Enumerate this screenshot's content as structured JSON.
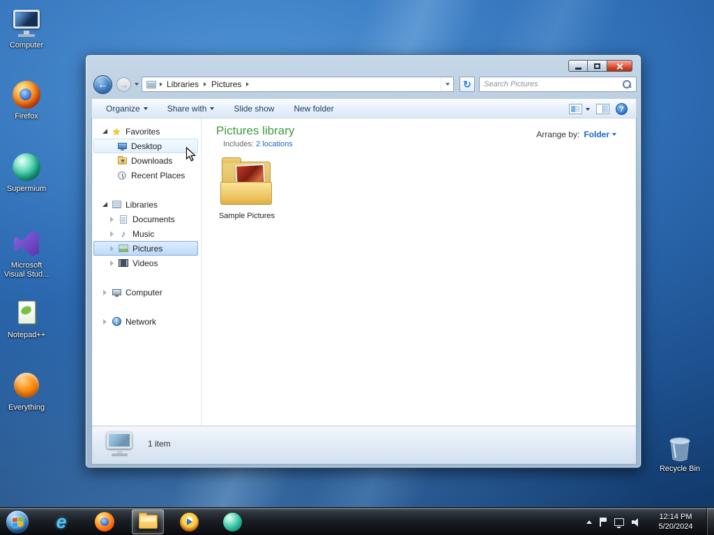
{
  "colors": {
    "selection_blue": "#84acdd",
    "library_title_green": "#3e9b3e",
    "link_blue": "#1a66cc",
    "toolbar_text": "#1e3c5a",
    "close_button_red": "#c03318"
  },
  "desktop": {
    "icons": [
      {
        "label": "Computer"
      },
      {
        "label": "Firefox"
      },
      {
        "label": "Supermium"
      },
      {
        "label": "Microsoft Visual Stud..."
      },
      {
        "label": "Notepad++"
      },
      {
        "label": "Everything"
      },
      {
        "label": "Recycle Bin"
      }
    ]
  },
  "window": {
    "nav": {
      "breadcrumb": [
        {
          "label": "Libraries"
        },
        {
          "label": "Pictures"
        }
      ],
      "search_placeholder": "Search Pictures"
    },
    "toolbar": {
      "organize": "Organize",
      "share_with": "Share with",
      "slide_show": "Slide show",
      "new_folder": "New folder"
    },
    "sidebar": {
      "favorites": {
        "label": "Favorites",
        "items": [
          {
            "label": "Desktop"
          },
          {
            "label": "Downloads"
          },
          {
            "label": "Recent Places"
          }
        ]
      },
      "libraries": {
        "label": "Libraries",
        "items": [
          {
            "label": "Documents"
          },
          {
            "label": "Music"
          },
          {
            "label": "Pictures"
          },
          {
            "label": "Videos"
          }
        ]
      },
      "computer": {
        "label": "Computer"
      },
      "network": {
        "label": "Network"
      }
    },
    "content": {
      "title": "Pictures library",
      "includes_label": "Includes:",
      "includes_link": "2 locations",
      "arrange_label": "Arrange by:",
      "arrange_value": "Folder",
      "items": [
        {
          "label": "Sample Pictures"
        }
      ]
    },
    "details": {
      "item_count": "1 item"
    }
  },
  "taskbar": {
    "clock_time": "12:14 PM",
    "clock_date": "5/20/2024"
  },
  "icons": {
    "back_arrow": "←",
    "forward_arrow": "→",
    "refresh": "↻",
    "help": "?",
    "ie": "e",
    "star": "★",
    "music_note": "♪"
  }
}
